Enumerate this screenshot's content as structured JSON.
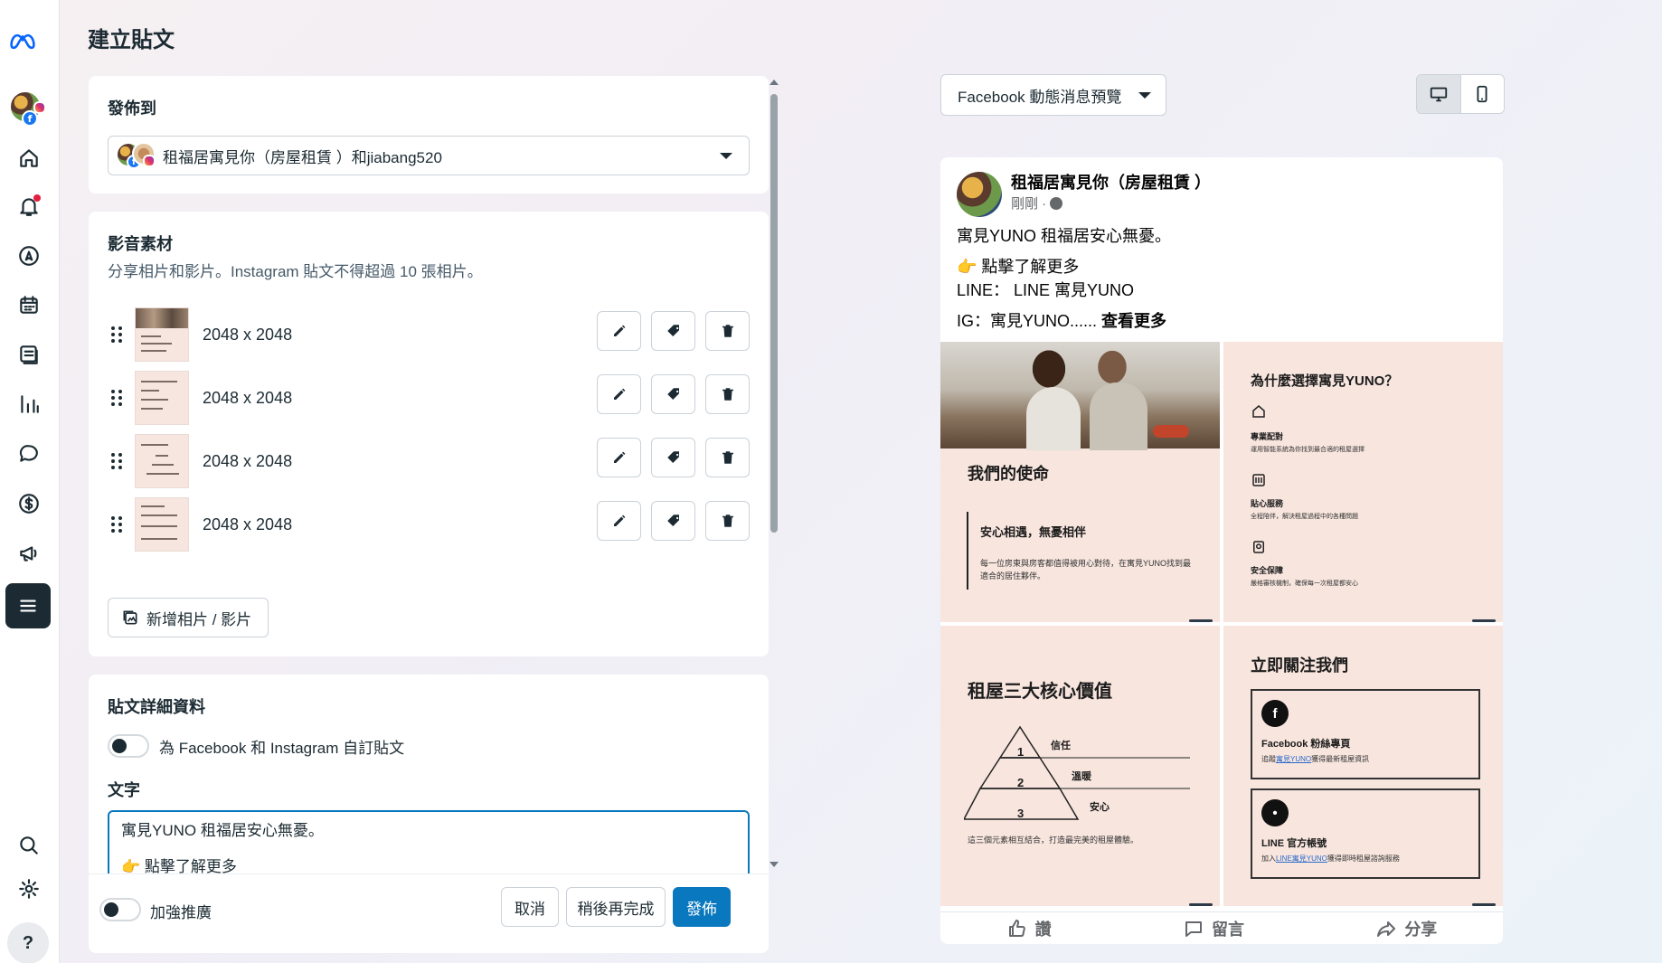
{
  "page": {
    "title": "建立貼文"
  },
  "publish_to": {
    "heading": "發佈到",
    "selected": "租福居寓見你（房屋租賃 ）和jiabang520"
  },
  "media": {
    "heading": "影音素材",
    "subtitle": "分享相片和影片。Instagram 貼文不得超過 10 張相片。",
    "items": [
      {
        "dims": "2048 x 2048"
      },
      {
        "dims": "2048 x 2048"
      },
      {
        "dims": "2048 x 2048"
      },
      {
        "dims": "2048 x 2048"
      }
    ],
    "add_label": "新增相片 / 影片"
  },
  "details": {
    "heading": "貼文詳細資料",
    "customize_label": "為 Facebook 和 Instagram 自訂貼文",
    "text_label": "文字",
    "text_line1": "寓見YUNO 租福居安心無憂。",
    "text_line2": "點擊了解更多"
  },
  "footer": {
    "boost_label": "加強推廣",
    "cancel": "取消",
    "later": "稍後再完成",
    "publish": "發佈"
  },
  "preview": {
    "select_label": "Facebook 動態消息預覽",
    "page_name": "租福居寓見你（房屋租賃 ）",
    "time": "剛剛 ·",
    "line1": "寓見YUNO 租福居安心無憂。",
    "line2": "點擊了解更多",
    "line3": "LINE： LINE 寓見YUNO",
    "line4": "IG：寓見YUNO......",
    "see_more": "查看更多",
    "tile1": {
      "title": "我們的使命",
      "sub": "安心相遇，無憂相伴",
      "body1": "每一位房東與房客都值得被用心對待，在寓見YUNO找到最",
      "body2": "適合的居住夥伴。"
    },
    "tile2": {
      "title": "為什麼選擇寓見YUNO？",
      "f1_title": "專業配對",
      "f1_body": "運用智能系統為你找到最合適的租屋選擇",
      "f2_title": "貼心服務",
      "f2_body": "全程陪伴，解決租屋過程中的各種問題",
      "f3_title": "安全保障",
      "f3_body": "嚴格審核機制，確保每一次租屋都安心"
    },
    "tile3": {
      "title": "租屋三大核心價值",
      "v1": "信任",
      "v2": "溫暖",
      "v3": "安心",
      "n1": "1",
      "n2": "2",
      "n3": "3",
      "caption": "這三個元素相互結合，打造最完美的租屋體驗。"
    },
    "tile4": {
      "title": "立即關注我們",
      "fb_title": "Facebook 粉絲專頁",
      "fb_body_pre": "追蹤",
      "fb_body_link": "寓見YUNO",
      "fb_body_post": "獲得最新租屋資訊",
      "line_title": "LINE 官方帳號",
      "line_body_pre": "加入",
      "line_body_link": "LINE寓見YUNO",
      "line_body_post": "獲得即時租屋諮詢服務"
    },
    "actions": {
      "like": "讚",
      "comment": "留言",
      "share": "分享"
    }
  },
  "colors": {
    "primary": "#0a78be",
    "rail_active": "#1c2b33",
    "tile_bg": "#f7e5de"
  },
  "icons": [
    "meta-logo",
    "home-icon",
    "bell-icon",
    "compass-icon",
    "calendar-icon",
    "content-icon",
    "insights-icon",
    "chat-icon",
    "dollar-icon",
    "megaphone-icon",
    "menu-icon",
    "search-icon",
    "gear-icon",
    "help-icon"
  ]
}
